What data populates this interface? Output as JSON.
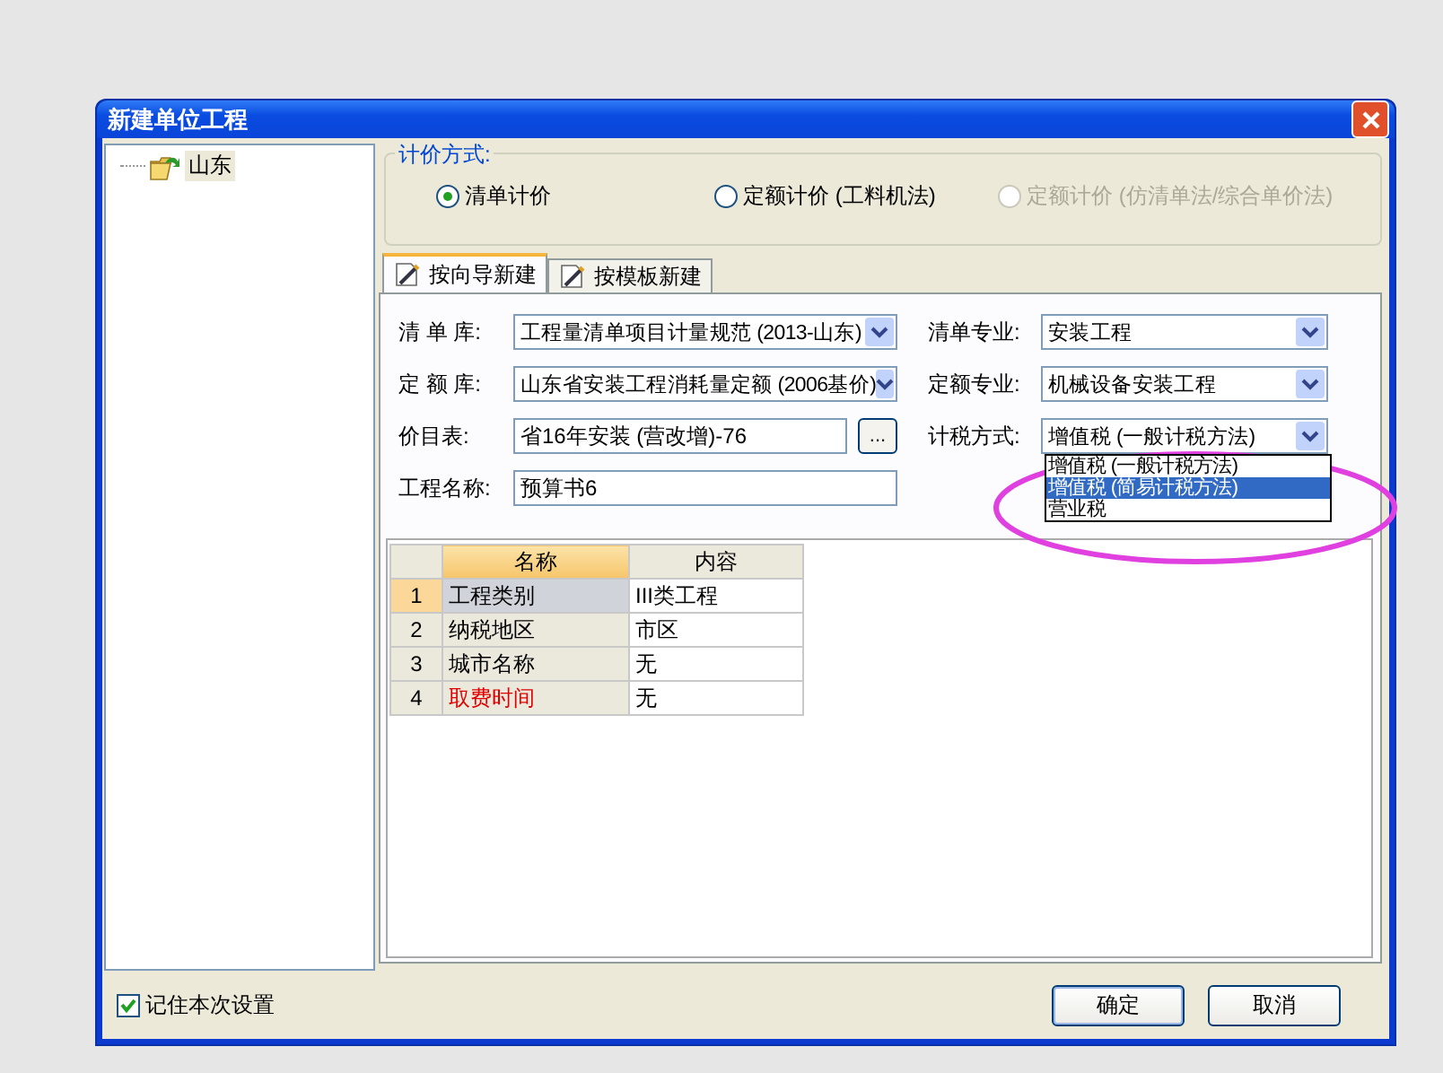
{
  "window": {
    "title": "新建单位工程"
  },
  "tree": {
    "items": [
      {
        "label": "山东",
        "selected": true
      }
    ]
  },
  "pricing_method": {
    "label": "计价方式:",
    "options": [
      {
        "label": "清单计价",
        "selected": true,
        "disabled": false
      },
      {
        "label": "定额计价 (工料机法)",
        "selected": false,
        "disabled": false
      },
      {
        "label": "定额计价 (仿清单法/综合单价法)",
        "selected": false,
        "disabled": true
      }
    ]
  },
  "tabs": [
    {
      "label": "按向导新建",
      "selected": true
    },
    {
      "label": "按模板新建",
      "selected": false
    }
  ],
  "fields": [
    {
      "kind": "combo",
      "label": "清 单 库:",
      "value": "工程量清单项目计量规范 (2013-山东)"
    },
    {
      "kind": "combo",
      "label": "清单专业:",
      "value": "安装工程"
    },
    {
      "kind": "combo",
      "label": "定 额 库:",
      "value": "山东省安装工程消耗量定额 (2006基价)"
    },
    {
      "kind": "combo",
      "label": "定额专业:",
      "value": "机械设备安装工程"
    },
    {
      "kind": "browse",
      "label": "价目表:",
      "value": "省16年安装 (营改增)-76",
      "button": "..."
    },
    {
      "kind": "combo",
      "label": "计税方式:",
      "value": "增值税 (一般计税方法)",
      "open": true,
      "options": [
        {
          "label": "增值税 (一般计税方法)",
          "highlighted": false
        },
        {
          "label": "增值税 (简易计税方法)",
          "highlighted": true
        },
        {
          "label": "营业税",
          "highlighted": false
        }
      ]
    },
    {
      "kind": "text",
      "label": "工程名称:",
      "value": "预算书6"
    }
  ],
  "table": {
    "columns": [
      "名称",
      "内容"
    ],
    "rows": [
      {
        "number": "1",
        "name": "工程类别",
        "value": "III类工程",
        "selected": true,
        "color": "#000000"
      },
      {
        "number": "2",
        "name": "纳税地区",
        "value": "市区",
        "selected": false,
        "color": "#000000"
      },
      {
        "number": "3",
        "name": "城市名称",
        "value": "无",
        "selected": false,
        "color": "#000000"
      },
      {
        "number": "4",
        "name": "取费时间",
        "value": "无",
        "selected": false,
        "color": "#e00000"
      }
    ]
  },
  "remember": {
    "label": "记住本次设置",
    "checked": true
  },
  "buttons": [
    "确定",
    "取消"
  ]
}
